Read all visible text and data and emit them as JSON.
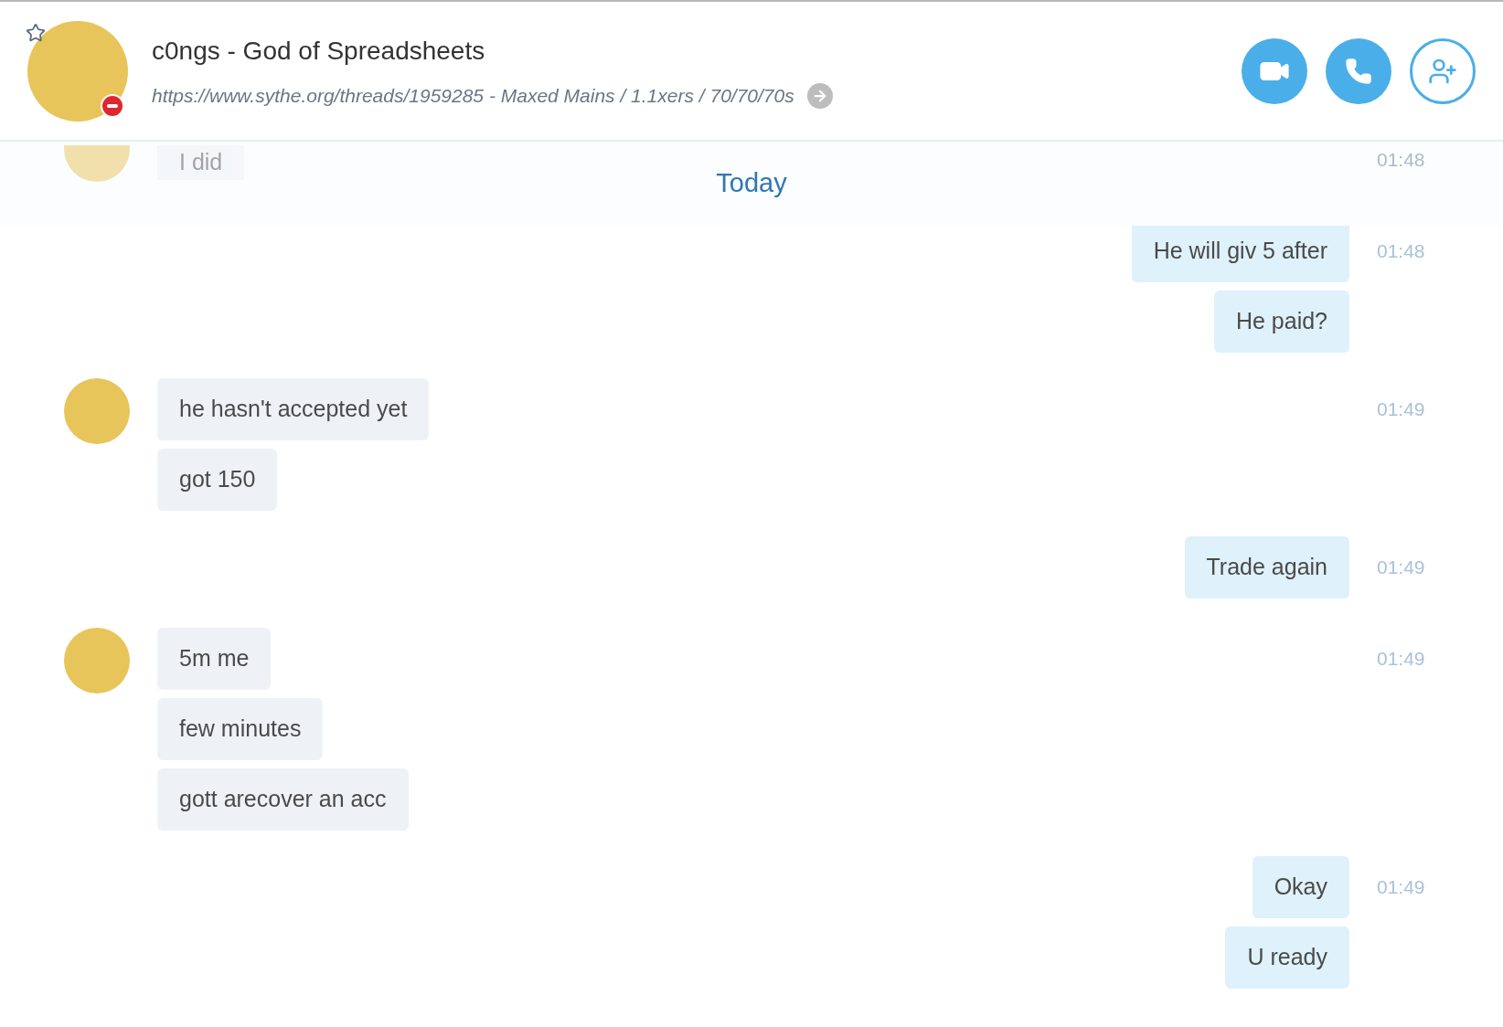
{
  "header": {
    "name": "c0ngs - God of Spreadsheets",
    "mood": "https://www.sythe.org/threads/1959285 - Maxed Mains / 1.1xers / 70/70/70s",
    "favorite": false,
    "busy": true
  },
  "date_divider": "Today",
  "faded_message": {
    "text": "I did",
    "time": "01:48"
  },
  "groups": [
    {
      "kind": "outgoing",
      "time": "01:48",
      "messages": [
        "He will giv 5 after",
        "He paid?"
      ]
    },
    {
      "kind": "incoming",
      "time": "01:49",
      "messages": [
        "he hasn't accepted yet",
        "got 150"
      ]
    },
    {
      "kind": "outgoing",
      "time": "01:49",
      "messages": [
        "Trade again"
      ]
    },
    {
      "kind": "incoming",
      "time": "01:49",
      "messages": [
        "5m me",
        "few minutes",
        "gott arecover an acc"
      ]
    },
    {
      "kind": "outgoing",
      "time": "01:49",
      "messages": [
        "Okay",
        "U ready"
      ]
    }
  ]
}
